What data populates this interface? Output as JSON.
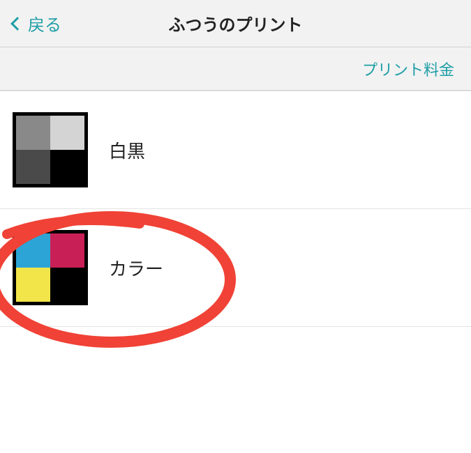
{
  "nav": {
    "back_label": "戻る",
    "title": "ふつうのプリント"
  },
  "price_link": "プリント料金",
  "options": [
    {
      "label": "白黒"
    },
    {
      "label": "カラー"
    }
  ]
}
